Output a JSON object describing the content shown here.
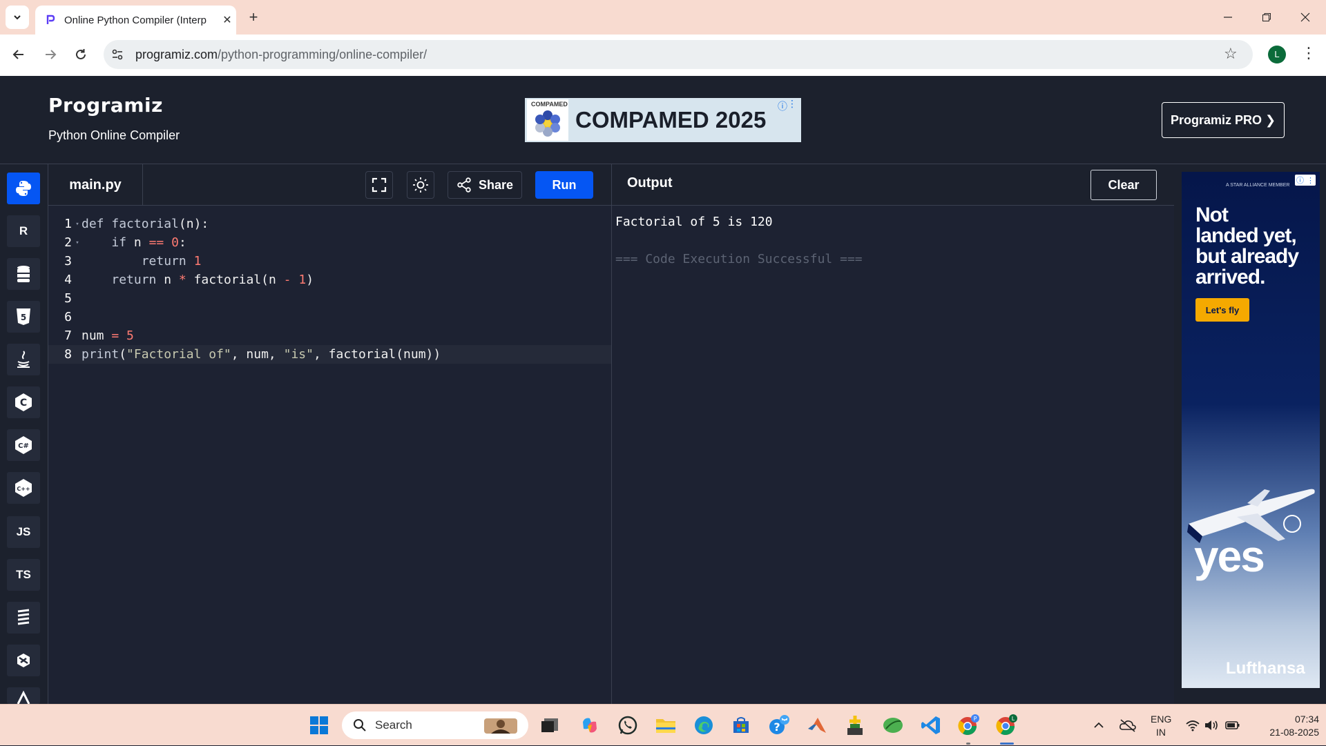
{
  "browser": {
    "tab_title": "Online Python Compiler (Interp",
    "url_host": "programiz.com",
    "url_path": "/python-programming/online-compiler/",
    "profile_initial": "L"
  },
  "header": {
    "logo": "Programiz",
    "subtitle": "Python Online Compiler",
    "ad_small": "COMPAMED",
    "ad_text": "COMPAMED 2025",
    "pro_button": "Programiz PRO ❯"
  },
  "sidebar": {
    "langs": [
      {
        "name": "python",
        "label": "",
        "active": true
      },
      {
        "name": "r",
        "label": "R"
      },
      {
        "name": "sql",
        "label": ""
      },
      {
        "name": "html",
        "label": "5"
      },
      {
        "name": "java",
        "label": ""
      },
      {
        "name": "c",
        "label": "C"
      },
      {
        "name": "csharp",
        "label": "C#"
      },
      {
        "name": "cpp",
        "label": "C++"
      },
      {
        "name": "js",
        "label": "JS"
      },
      {
        "name": "ts",
        "label": "TS"
      },
      {
        "name": "go",
        "label": ""
      },
      {
        "name": "swift",
        "label": ""
      },
      {
        "name": "rust",
        "label": ""
      }
    ]
  },
  "editor": {
    "file_name": "main.py",
    "share_label": "Share",
    "run_label": "Run",
    "lines": [
      "1",
      "2",
      "3",
      "4",
      "5",
      "6",
      "7",
      "8"
    ]
  },
  "output": {
    "title": "Output",
    "clear_label": "Clear",
    "result_line": "Factorial of 5 is 120",
    "status_line": "=== Code Execution Successful ==="
  },
  "side_ad": {
    "tiny": "A STAR ALLIANCE MEMBER",
    "headline_1": "Not",
    "headline_2": "landed yet,",
    "headline_3": "but already",
    "headline_4": "arrived.",
    "cta": "Let's fly",
    "yes": "yes",
    "brand": "Lufthansa"
  },
  "taskbar": {
    "search_label": "Search",
    "lang_1": "ENG",
    "lang_2": "IN",
    "time": "07:34",
    "date": "21-08-2025"
  }
}
